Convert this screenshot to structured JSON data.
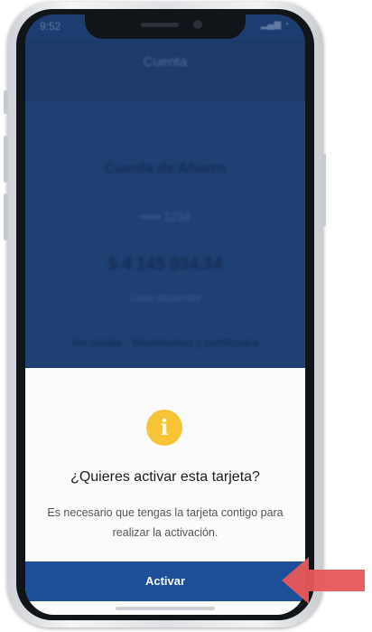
{
  "status_bar": {
    "time": "9:52",
    "icons": "▂▄▆ ◔"
  },
  "background": {
    "header_title": "Cuenta",
    "account_type": "Cuenta de Ahorro",
    "account_number": "•••••  1234",
    "balance": "$ 4 145 034.34",
    "balance_caption": "Saldo disponible",
    "links": "Ver detalle · Movimientos y certificados"
  },
  "dialog": {
    "icon": "info-icon",
    "icon_glyph": "i",
    "title": "¿Quieres activar esta tarjeta?",
    "message_line1": "Es necesario que tengas la tarjeta contigo para",
    "message_line2": "realizar la activación.",
    "button_label": "Activar"
  },
  "colors": {
    "primary": "#1c4f98",
    "overlay_blue": "#1d3d70",
    "warning_yellow": "#f6c434",
    "arrow_red": "#e8575a"
  }
}
